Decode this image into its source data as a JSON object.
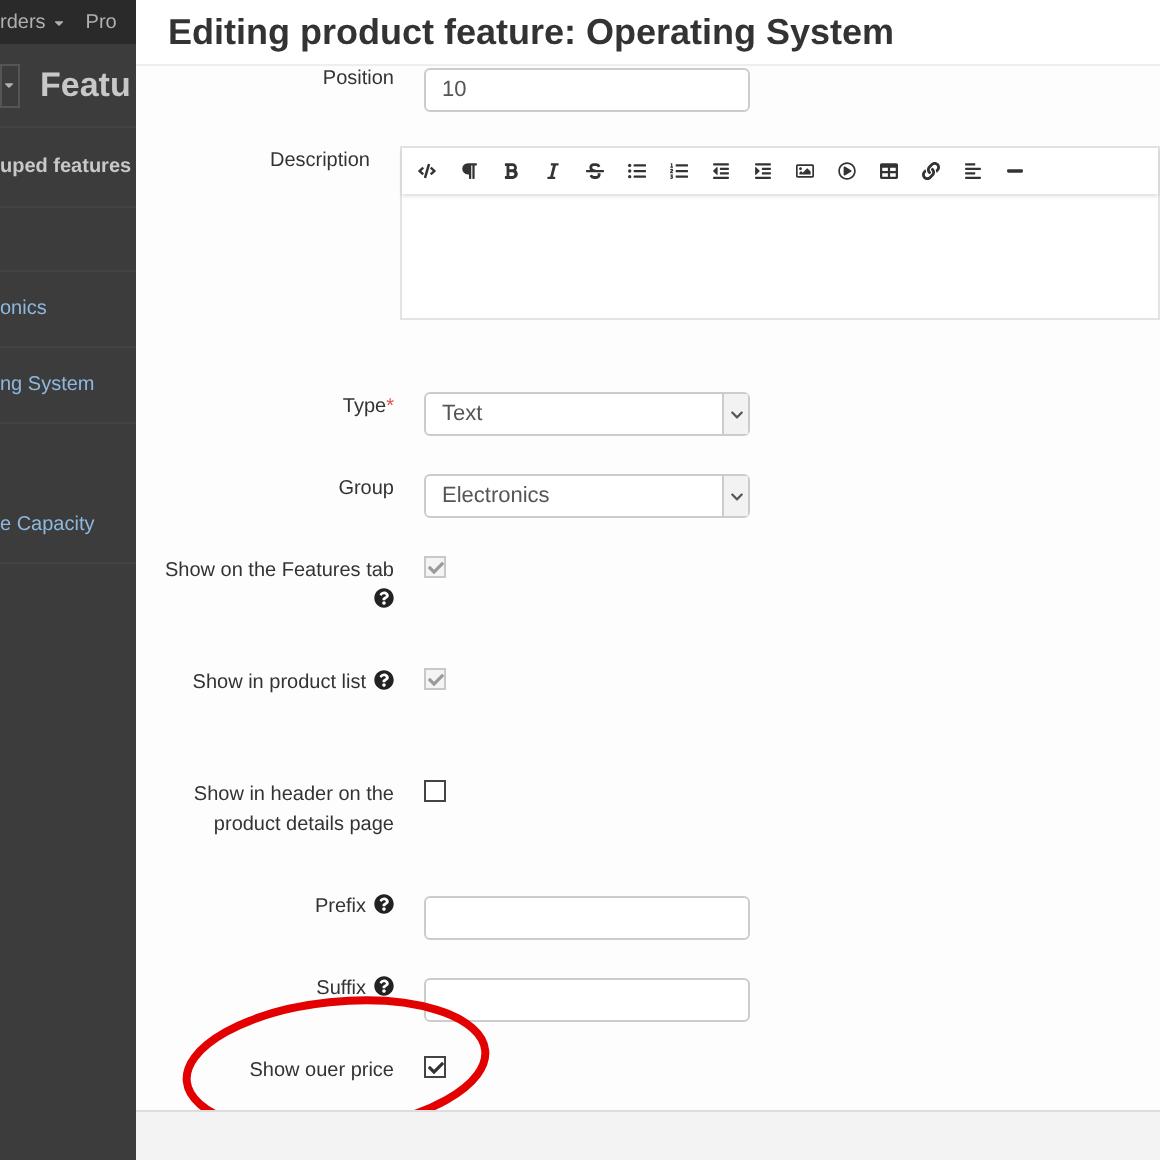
{
  "background": {
    "menu": [
      "rders",
      "Pro"
    ],
    "page_title": "Featu",
    "sidebar_heading": "uped features",
    "links": [
      "onics",
      "ng System",
      "e Capacity"
    ]
  },
  "dialog": {
    "title": "Editing product feature: Operating System",
    "fields": [
      {
        "kind": "text",
        "label": "Position",
        "value": "10",
        "help": false
      },
      {
        "kind": "editor",
        "label": "Description",
        "help": false
      },
      {
        "kind": "select",
        "label": "Type",
        "value": "Text",
        "required_mark": "*",
        "help": false
      },
      {
        "kind": "select",
        "label": "Group",
        "value": "Electronics",
        "help": false
      },
      {
        "kind": "checkbox",
        "label": "Show on the Features tab",
        "checked": true,
        "disabled": true,
        "help": true,
        "help_below": true
      },
      {
        "kind": "checkbox",
        "label": "Show in product list",
        "checked": true,
        "disabled": true,
        "help": true
      },
      {
        "kind": "checkbox",
        "label": "Show in header on the product details page",
        "checked": false,
        "disabled": false,
        "help": false
      },
      {
        "kind": "text",
        "label": "Prefix",
        "help": true
      },
      {
        "kind": "text",
        "label": "Suffix",
        "help": true
      },
      {
        "kind": "checkbox",
        "label": "Show ouer price",
        "checked": true,
        "disabled": false,
        "help": false,
        "circled": true
      }
    ]
  }
}
